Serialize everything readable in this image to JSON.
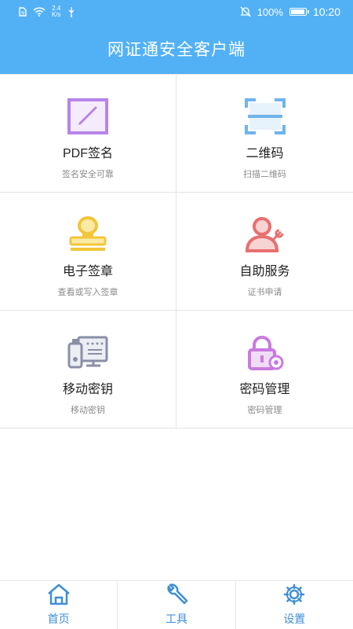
{
  "status_bar": {
    "net_speed_value": "2.4",
    "net_speed_unit": "K/s",
    "battery": "100%",
    "time": "10:20",
    "icons": [
      "sim-icon",
      "wifi-icon",
      "usb-icon",
      "mute-icon",
      "battery-icon"
    ]
  },
  "header": {
    "title": "网证通安全客户端"
  },
  "features": [
    {
      "title": "PDF签名",
      "subtitle": "签名安全可靠",
      "icon": "pdf-sign-icon",
      "color": "#b684e8"
    },
    {
      "title": "二维码",
      "subtitle": "扫描二维码",
      "icon": "qr-scan-icon",
      "color": "#6fb4ec"
    },
    {
      "title": "电子签章",
      "subtitle": "查看或写入签章",
      "icon": "seal-stamp-icon",
      "color": "#f2c63a"
    },
    {
      "title": "自助服务",
      "subtitle": "证书申请",
      "icon": "user-wrench-icon",
      "color": "#e86f6f"
    },
    {
      "title": "移动密钥",
      "subtitle": "移动密钥",
      "icon": "usb-key-icon",
      "color": "#8a8fa6"
    },
    {
      "title": "密码管理",
      "subtitle": "密码管理",
      "icon": "lock-gear-icon",
      "color": "#c97ae0"
    }
  ],
  "tabs": [
    {
      "label": "首页",
      "icon": "home-icon"
    },
    {
      "label": "工具",
      "icon": "wrench-icon"
    },
    {
      "label": "设置",
      "icon": "gear-icon"
    }
  ],
  "colors": {
    "accent": "#52b1f5",
    "tab_icon": "#3f8fd3"
  }
}
